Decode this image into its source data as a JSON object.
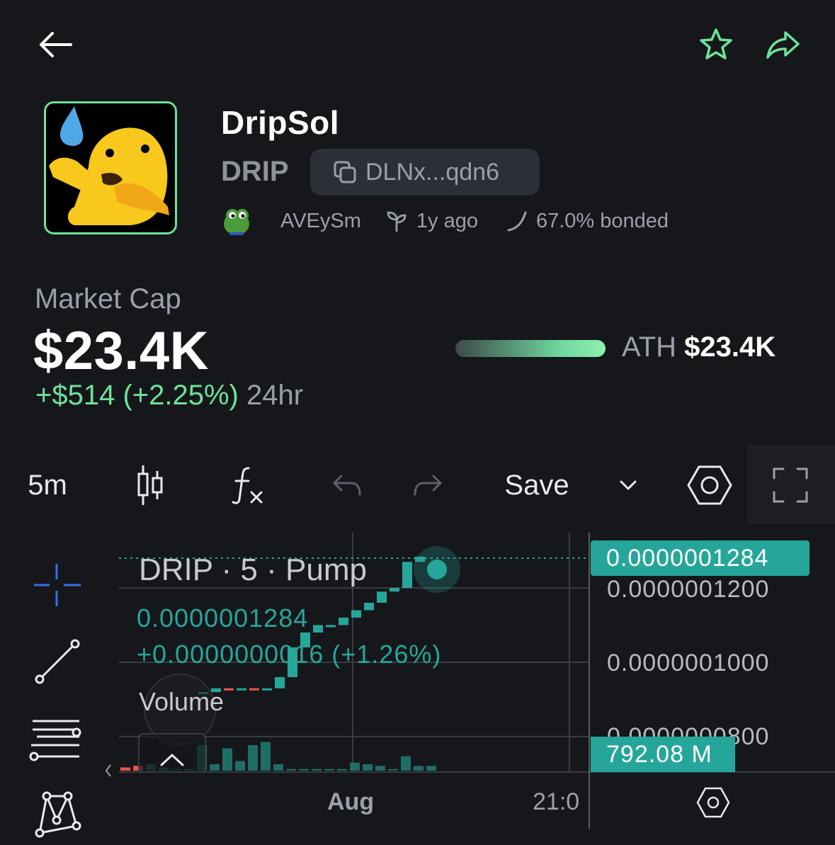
{
  "header": {
    "back_icon": "arrow-left-icon",
    "favorite_icon": "star-icon",
    "share_icon": "share-arrow-icon",
    "accent_color": "#6ee29a"
  },
  "token": {
    "name": "DripSol",
    "ticker": "DRIP",
    "address_short": "DLNx...qdn6",
    "creator": "AVEySm",
    "age": "1y ago",
    "bonded": "67.0% bonded"
  },
  "market": {
    "label": "Market Cap",
    "value": "$23.4K",
    "change_abs_pct": "+$514 (+2.25%)",
    "change_period": "24hr",
    "ath_label": "ATH",
    "ath_value": "$23.4K",
    "ath_progress": 1.0
  },
  "toolbar": {
    "interval": "5m",
    "save_label": "Save",
    "icons": [
      "candlestick-icon",
      "indicators-icon",
      "undo-icon",
      "redo-icon",
      "chevron-down-icon",
      "settings-hex-icon",
      "fullscreen-icon"
    ]
  },
  "chart": {
    "legend_title": "DRIP · 5 · Pump",
    "legend_price": "0.0000001284",
    "legend_change": "+0.0000000016 (+1.26%)",
    "volume_label": "Volume",
    "current_price_tag": "0.0000001284",
    "volume_tag": "792.08 M",
    "price_axis": [
      "0.0000001200",
      "0.0000001000",
      "0.0000000800"
    ],
    "time_axis": [
      "Aug",
      "21:0"
    ],
    "up_color": "#26a69a",
    "down_color": "#ef5350"
  },
  "chart_data": {
    "type": "candlestick",
    "title": "DRIP · 5 · Pump",
    "y_ticks": [
      1.2e-07,
      1e-07,
      8e-08
    ],
    "last_price": 1.284e-07,
    "candles_close": [
      9.2e-08,
      9.3e-08,
      9.25e-08,
      9.3e-08,
      9.25e-08,
      9.3e-08,
      9.6e-08,
      1.04e-07,
      1.08e-07,
      1.1e-07,
      1.1e-07,
      1.12e-07,
      1.14e-07,
      1.16e-07,
      1.19e-07,
      1.2e-07,
      1.27e-07,
      1.284e-07
    ],
    "volume_label": "Volume",
    "last_volume": "792.08 M",
    "x_ticks": [
      "Aug",
      "21:0"
    ]
  }
}
